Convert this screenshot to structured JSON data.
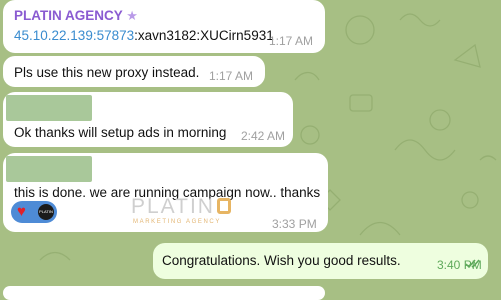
{
  "messages": [
    {
      "sender": "PLATIN AGENCY",
      "sender_badge": "★",
      "link_text": "45.10.22.139:57873",
      "text_rest": ":xavn3182:XUCirn5931",
      "time": "1:17 AM"
    },
    {
      "text": "Pls use this new proxy instead.",
      "time": "1:17 AM"
    },
    {
      "text": "Ok thanks will setup ads in morning",
      "time": "2:42 AM"
    },
    {
      "text": "this is done. we are running campaign now.. thanks",
      "reaction_emoji": "♥",
      "reaction_avatar_text": "PLATIN",
      "logo_word": "PLATIN",
      "logo_sub": "MARKETING AGENCY",
      "time": "3:33 PM"
    }
  ],
  "outgoing": {
    "text": "Congratulations. Wish you good results.",
    "time": "3:40 PM",
    "status_icon": "double-check-icon"
  },
  "colors": {
    "background": "#a7bf84",
    "incoming_bubble": "#ffffff",
    "outgoing_bubble": "#eefedf",
    "sender": "#8a5bd1",
    "link": "#3a8ccf",
    "reaction": "#4e8bd6"
  }
}
